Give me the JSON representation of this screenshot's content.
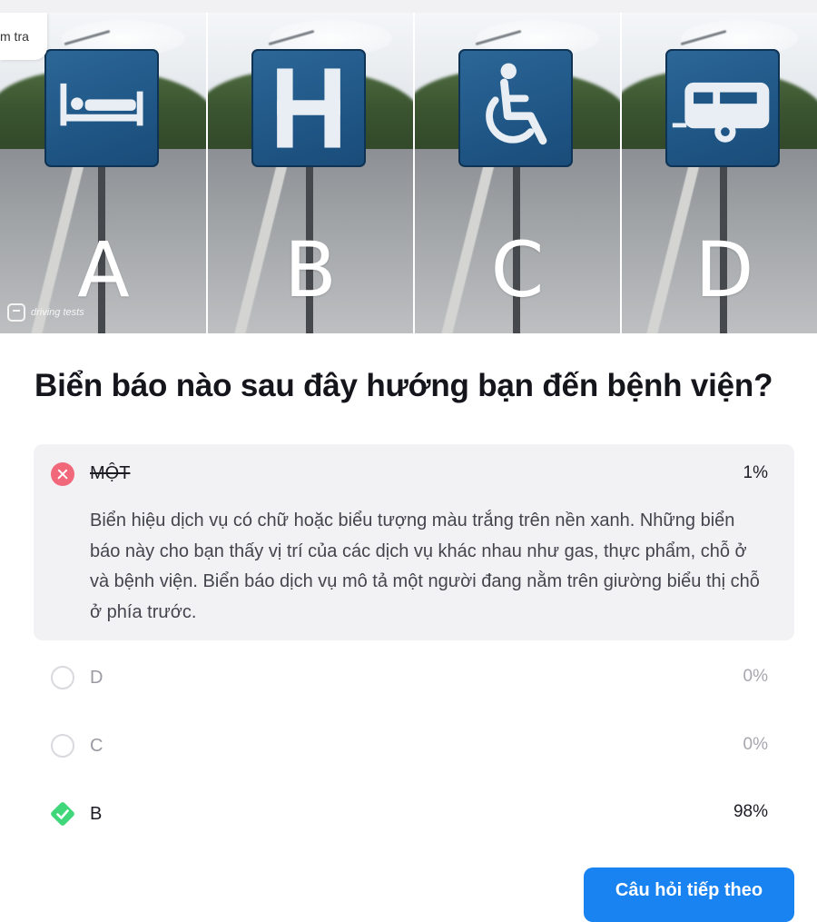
{
  "image": {
    "tooltip_text": "m tra",
    "watermark_text": "driving tests",
    "panels": [
      {
        "letter": "A",
        "symbol": "bed-icon"
      },
      {
        "letter": "B",
        "symbol": "hospital-h-icon"
      },
      {
        "letter": "C",
        "symbol": "wheelchair-icon"
      },
      {
        "letter": "D",
        "symbol": "caravan-icon"
      }
    ]
  },
  "question": "Biển báo nào sau đây hướng bạn đến bệnh viện?",
  "answers": [
    {
      "label": "MỘT",
      "percent": "1%",
      "state": "wrong-selected",
      "explanation": "Biển hiệu dịch vụ có chữ hoặc biểu tượng màu trắng trên nền xanh. Những biển báo này cho bạn thấy vị trí của các dịch vụ khác nhau như gas, thực phẩm, chỗ ở và bệnh viện. Biển báo dịch vụ mô tả một người đang nằm trên giường biểu thị chỗ ở phía trước."
    },
    {
      "label": "D",
      "percent": "0%",
      "state": "unselected"
    },
    {
      "label": "C",
      "percent": "0%",
      "state": "unselected"
    },
    {
      "label": "B",
      "percent": "98%",
      "state": "correct"
    }
  ],
  "next_button_label": "Câu hỏi tiếp theo",
  "colors": {
    "wrong": "#f0687a",
    "correct": "#3fd77a",
    "button": "#1a83f2",
    "sign_blue": "#1f5686"
  }
}
